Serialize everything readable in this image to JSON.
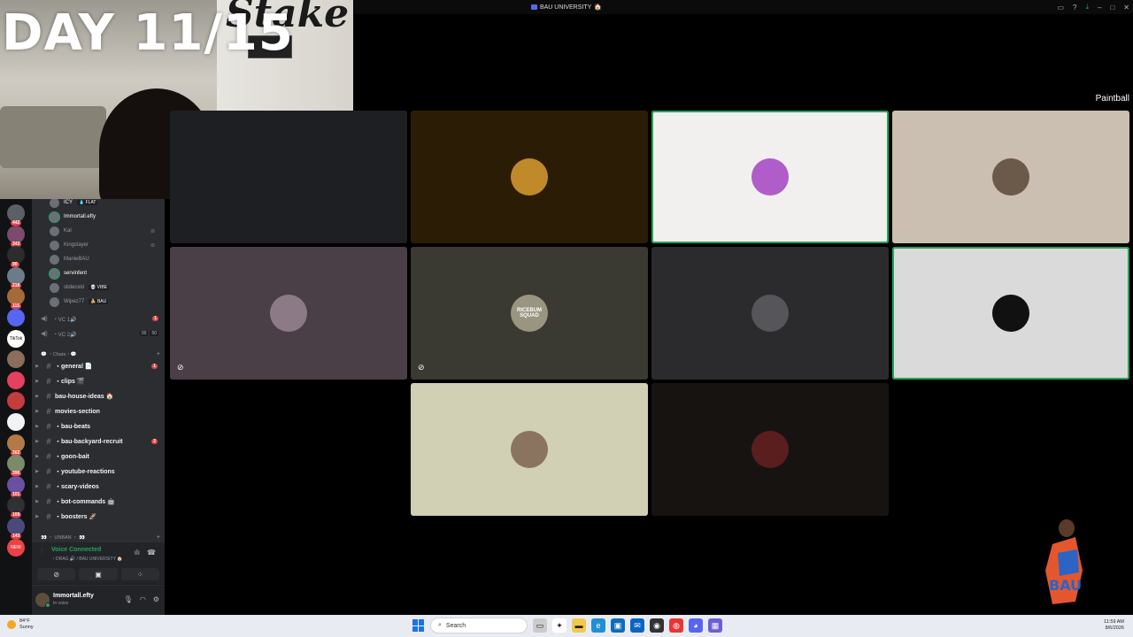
{
  "window": {
    "title": "BAU UNIVERSITY",
    "title_emoji": "🏠"
  },
  "overlay": {
    "day_text": "DAY 11/15",
    "wall_sign": "Stake"
  },
  "stage_label": "Paintball",
  "servers": [
    {
      "color": "#5c5f66",
      "badge": "442"
    },
    {
      "color": "#7b4a6c",
      "badge": "343"
    },
    {
      "color": "#2c2c2c",
      "badge": "90"
    },
    {
      "color": "#6b7b8a",
      "badge": "218"
    },
    {
      "color": "#a46a3a",
      "badge": "115"
    },
    {
      "color": "#5865f2",
      "badge": ""
    },
    {
      "color": "#ffffff",
      "badge": "",
      "label": "TikTok"
    },
    {
      "color": "#8a6d5a",
      "badge": ""
    },
    {
      "color": "#e4405f",
      "badge": ""
    },
    {
      "color": "#c43c3c",
      "badge": ""
    },
    {
      "color": "#f2f3f5",
      "badge": ""
    },
    {
      "color": "#b37a45",
      "badge": "302"
    },
    {
      "color": "#7a8b6a",
      "badge": "396"
    },
    {
      "color": "#6b4fa0",
      "badge": "101"
    },
    {
      "color": "#2f3136",
      "badge": "109"
    },
    {
      "color": "#4a4a7a",
      "badge": "143"
    },
    {
      "color": "#ed4245",
      "badge": "",
      "label": "NEW"
    }
  ],
  "voice_users": [
    {
      "name": "ICY",
      "tag": "💧 FLAT",
      "active": true,
      "ring": false,
      "muted": false
    },
    {
      "name": "Immortall.efty",
      "tag": "",
      "active": true,
      "ring": true,
      "muted": false
    },
    {
      "name": "Kal",
      "tag": "",
      "active": false,
      "ring": false,
      "muted": true
    },
    {
      "name": "Kingslayer",
      "tag": "",
      "active": false,
      "ring": false,
      "muted": true
    },
    {
      "name": "ManieBAU",
      "tag": "",
      "active": false,
      "ring": false,
      "muted": false
    },
    {
      "name": "servinfent",
      "tag": "",
      "active": true,
      "ring": true,
      "muted": false
    },
    {
      "name": "slidecxld",
      "tag": "💀 VIBE",
      "active": false,
      "ring": false,
      "muted": false
    },
    {
      "name": "Wipez77",
      "tag": "🍌 BAU",
      "active": false,
      "ring": false,
      "muted": false
    }
  ],
  "voice_channels": [
    {
      "name": "・VC 1🔊",
      "badge": "1",
      "counts": []
    },
    {
      "name": "・VC 2🔊",
      "badge": "",
      "counts": [
        "00",
        "50"
      ]
    }
  ],
  "categories": {
    "chats": "💬 ・Chats・💬",
    "unban": "👀 ・ UNBAN ・ 👀"
  },
  "text_channels": [
    {
      "name": "・general 📄",
      "badge": "1"
    },
    {
      "name": "・clips 🎬",
      "badge": ""
    },
    {
      "name": "bau-house-ideas 🏠",
      "badge": ""
    },
    {
      "name": "movies-section",
      "badge": ""
    },
    {
      "name": "・bau-beats",
      "badge": ""
    },
    {
      "name": "・bau-backyard-recruit",
      "badge": "2"
    },
    {
      "name": "・goon-bait",
      "badge": ""
    },
    {
      "name": "・youtube-reactions",
      "badge": ""
    },
    {
      "name": "・scary-videos",
      "badge": ""
    },
    {
      "name": "・bot-commands 🤖",
      "badge": ""
    },
    {
      "name": "・boosters 🚀",
      "badge": ""
    }
  ],
  "voice_panel": {
    "status": "Voice Connected",
    "location": "・DRAG 🔊 / BAU UNIVERSITY 🏠"
  },
  "user": {
    "name": "Immortall.efty",
    "status": "In voice"
  },
  "tiles": [
    {
      "bg": "#1e1f22",
      "avatar_color": "#1e1f22",
      "avatar_text": "",
      "speaking": false,
      "muted": false
    },
    {
      "bg": "#2b1d05",
      "avatar_color": "#c08a2a",
      "avatar_text": "",
      "speaking": false,
      "muted": false
    },
    {
      "bg": "#f1f0ef",
      "avatar_color": "#b05cc9",
      "avatar_text": "",
      "speaking": true,
      "muted": false
    },
    {
      "bg": "#cbbfb1",
      "avatar_color": "#6b5a4a",
      "avatar_text": "",
      "speaking": false,
      "muted": false
    },
    {
      "bg": "#4a3f47",
      "avatar_color": "#8c7a86",
      "avatar_text": "",
      "speaking": false,
      "muted": true
    },
    {
      "bg": "#3a3932",
      "avatar_color": "#9a9580",
      "avatar_text": "RICEBUM SQUAD",
      "speaking": false,
      "muted": true
    },
    {
      "bg": "#2b2b2d",
      "avatar_color": "#55555a",
      "avatar_text": "",
      "speaking": false,
      "muted": false
    },
    {
      "bg": "#dadada",
      "avatar_color": "#111111",
      "avatar_text": "",
      "speaking": true,
      "muted": false
    },
    {
      "bg": "#d1cfb4",
      "avatar_color": "#8a7460",
      "avatar_text": "",
      "speaking": false,
      "muted": false
    },
    {
      "bg": "#171311",
      "avatar_color": "#5a1e1e",
      "avatar_text": "",
      "speaking": false,
      "muted": false
    }
  ],
  "taskbar": {
    "weather_temp": "84°F",
    "weather_desc": "Sunny",
    "search_placeholder": "Search",
    "time": "11:59 AM",
    "date": "8/6/2026"
  }
}
